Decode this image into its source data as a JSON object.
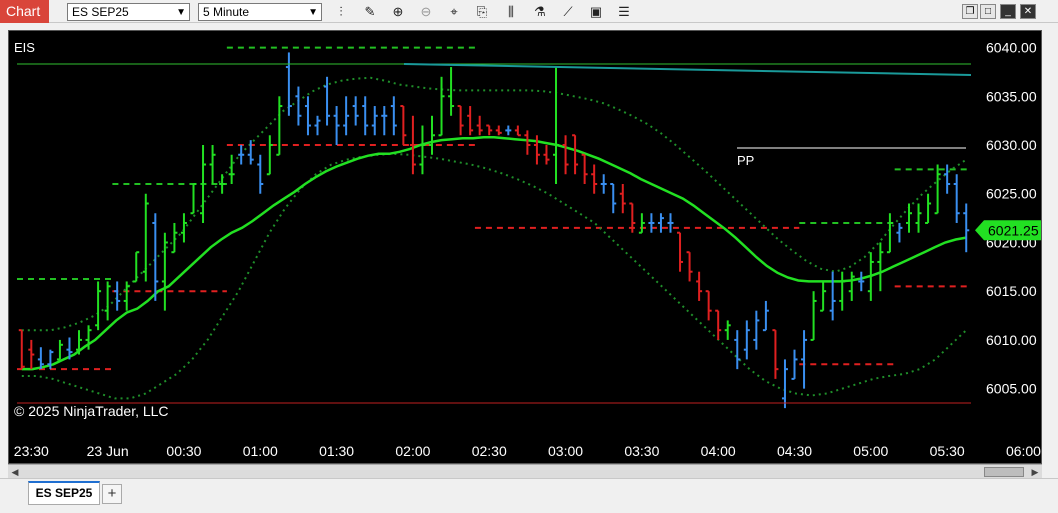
{
  "window": {
    "chart_label": "Chart"
  },
  "toolbar": {
    "instrument_select": "ES SEP25",
    "interval_select": "5 Minute",
    "icons": [
      "bar-type-icon",
      "draw-pencil-icon",
      "zoom-in-icon",
      "zoom-out-icon",
      "crosshair-icon",
      "properties-icon",
      "indicators-icon",
      "strategies-icon",
      "chart-trader-icon",
      "data-box-icon"
    ],
    "window_buttons": [
      "restore",
      "maximize",
      "minimize",
      "close"
    ]
  },
  "chart": {
    "instrument_label": "EIS",
    "copyright": "© 2025 NinjaTrader, LLC",
    "pivot_label": "PP",
    "last_price": "6021.25",
    "colors": {
      "background": "#000000",
      "up_bar": "#22e022",
      "down_bar": "#e02020",
      "neutral_bar": "#3a8ff0",
      "sma": "#22e022",
      "band": "#1f8f2a",
      "last_price_tag": "#22e022"
    },
    "y_axis_ticks": [
      "6040.00",
      "6035.00",
      "6030.00",
      "6025.00",
      "6020.00",
      "6015.00",
      "6010.00",
      "6005.00"
    ],
    "x_axis_ticks": [
      "23:30",
      "23 Jun",
      "00:30",
      "01:00",
      "01:30",
      "02:00",
      "02:30",
      "03:00",
      "03:30",
      "04:00",
      "04:30",
      "05:00",
      "05:30",
      "06:00"
    ]
  },
  "chart_data": {
    "type": "ohlc",
    "ylim": [
      6002.5,
      6041.7
    ],
    "bars": [
      {
        "o": 6011,
        "h": 6011,
        "l": 6007,
        "c": 6007.25,
        "d": -1
      },
      {
        "o": 6009,
        "h": 6010,
        "l": 6007,
        "c": 6008.5,
        "d": -1
      },
      {
        "o": 6008,
        "h": 6009.25,
        "l": 6007,
        "c": 6007.5,
        "d": 0
      },
      {
        "o": 6007.5,
        "h": 6009,
        "l": 6007,
        "c": 6008.75,
        "d": 0
      },
      {
        "o": 6008,
        "h": 6010,
        "l": 6008,
        "c": 6009.5,
        "d": 1
      },
      {
        "o": 6009,
        "h": 6010.25,
        "l": 6008,
        "c": 6008.75,
        "d": 0
      },
      {
        "o": 6009,
        "h": 6011,
        "l": 6008.5,
        "c": 6010,
        "d": 1
      },
      {
        "o": 6010,
        "h": 6011.5,
        "l": 6009,
        "c": 6011,
        "d": 1
      },
      {
        "o": 6011.5,
        "h": 6016,
        "l": 6011,
        "c": 6015,
        "d": 1
      },
      {
        "o": 6013,
        "h": 6016,
        "l": 6012,
        "c": 6015.5,
        "d": 1
      },
      {
        "o": 6015,
        "h": 6016,
        "l": 6013,
        "c": 6014,
        "d": 0
      },
      {
        "o": 6014,
        "h": 6016,
        "l": 6013,
        "c": 6015.5,
        "d": 1
      },
      {
        "o": 6016,
        "h": 6019,
        "l": 6016,
        "c": 6019,
        "d": 1
      },
      {
        "o": 6017,
        "h": 6025,
        "l": 6016,
        "c": 6024,
        "d": 1
      },
      {
        "o": 6022,
        "h": 6023,
        "l": 6014,
        "c": 6016,
        "d": 0
      },
      {
        "o": 6016,
        "h": 6021,
        "l": 6013,
        "c": 6020,
        "d": 1
      },
      {
        "o": 6019,
        "h": 6022,
        "l": 6019,
        "c": 6021,
        "d": 1
      },
      {
        "o": 6021,
        "h": 6023,
        "l": 6020,
        "c": 6022,
        "d": 1
      },
      {
        "o": 6023,
        "h": 6026,
        "l": 6023,
        "c": 6026,
        "d": 1
      },
      {
        "o": 6023,
        "h": 6030,
        "l": 6022,
        "c": 6028,
        "d": 1
      },
      {
        "o": 6028,
        "h": 6030,
        "l": 6026,
        "c": 6029,
        "d": 1
      },
      {
        "o": 6026,
        "h": 6027,
        "l": 6025,
        "c": 6026,
        "d": 1
      },
      {
        "o": 6027,
        "h": 6029,
        "l": 6026,
        "c": 6027,
        "d": 1
      },
      {
        "o": 6029,
        "h": 6030,
        "l": 6028,
        "c": 6029,
        "d": 0
      },
      {
        "o": 6029,
        "h": 6030.5,
        "l": 6028,
        "c": 6028.5,
        "d": 0
      },
      {
        "o": 6028,
        "h": 6029,
        "l": 6025,
        "c": 6026,
        "d": 0
      },
      {
        "o": 6027,
        "h": 6031,
        "l": 6027,
        "c": 6030,
        "d": 1
      },
      {
        "o": 6029,
        "h": 6035,
        "l": 6029,
        "c": 6034,
        "d": 1
      },
      {
        "o": 6038,
        "h": 6039.5,
        "l": 6033,
        "c": 6034,
        "d": 0
      },
      {
        "o": 6035,
        "h": 6036,
        "l": 6032,
        "c": 6033,
        "d": 0
      },
      {
        "o": 6034,
        "h": 6035,
        "l": 6031,
        "c": 6032,
        "d": 0
      },
      {
        "o": 6032,
        "h": 6033,
        "l": 6031,
        "c": 6032.5,
        "d": 0
      },
      {
        "o": 6036,
        "h": 6037,
        "l": 6032,
        "c": 6033,
        "d": 0
      },
      {
        "o": 6033,
        "h": 6034,
        "l": 6030,
        "c": 6032,
        "d": 0
      },
      {
        "o": 6032,
        "h": 6035,
        "l": 6031,
        "c": 6033,
        "d": 0
      },
      {
        "o": 6034,
        "h": 6035,
        "l": 6032,
        "c": 6033,
        "d": 0
      },
      {
        "o": 6034,
        "h": 6035,
        "l": 6031,
        "c": 6032,
        "d": 0
      },
      {
        "o": 6032,
        "h": 6034,
        "l": 6031,
        "c": 6033,
        "d": 0
      },
      {
        "o": 6033,
        "h": 6034,
        "l": 6031,
        "c": 6033,
        "d": 0
      },
      {
        "o": 6034,
        "h": 6035,
        "l": 6031,
        "c": 6032,
        "d": 0
      },
      {
        "o": 6034,
        "h": 6034,
        "l": 6030,
        "c": 6031,
        "d": -1
      },
      {
        "o": 6030,
        "h": 6033,
        "l": 6027,
        "c": 6028,
        "d": -1
      },
      {
        "o": 6028,
        "h": 6032,
        "l": 6027,
        "c": 6030,
        "d": 1
      },
      {
        "o": 6030,
        "h": 6033,
        "l": 6029,
        "c": 6031,
        "d": 1
      },
      {
        "o": 6031,
        "h": 6037,
        "l": 6031,
        "c": 6035,
        "d": 1
      },
      {
        "o": 6035,
        "h": 6038,
        "l": 6033,
        "c": 6034,
        "d": 1
      },
      {
        "o": 6034,
        "h": 6034,
        "l": 6031,
        "c": 6032,
        "d": -1
      },
      {
        "o": 6033,
        "h": 6034,
        "l": 6031,
        "c": 6031.5,
        "d": -1
      },
      {
        "o": 6032,
        "h": 6033,
        "l": 6031,
        "c": 6031.5,
        "d": -1
      },
      {
        "o": 6032,
        "h": 6032,
        "l": 6031,
        "c": 6031.5,
        "d": -1
      },
      {
        "o": 6031.5,
        "h": 6032,
        "l": 6031,
        "c": 6031.25,
        "d": -1
      },
      {
        "o": 6031.5,
        "h": 6032,
        "l": 6031,
        "c": 6031.5,
        "d": 0
      },
      {
        "o": 6031.5,
        "h": 6032,
        "l": 6031,
        "c": 6031,
        "d": -1
      },
      {
        "o": 6031,
        "h": 6031.5,
        "l": 6029,
        "c": 6030,
        "d": -1
      },
      {
        "o": 6030,
        "h": 6031,
        "l": 6028,
        "c": 6029,
        "d": -1
      },
      {
        "o": 6029,
        "h": 6030,
        "l": 6028,
        "c": 6028.5,
        "d": -1
      },
      {
        "o": 6029,
        "h": 6038,
        "l": 6026,
        "c": 6030,
        "d": 1
      },
      {
        "o": 6030,
        "h": 6031,
        "l": 6027,
        "c": 6028,
        "d": -1
      },
      {
        "o": 6031,
        "h": 6031,
        "l": 6027,
        "c": 6028,
        "d": -1
      },
      {
        "o": 6029,
        "h": 6029,
        "l": 6026,
        "c": 6027,
        "d": -1
      },
      {
        "o": 6027,
        "h": 6028,
        "l": 6025,
        "c": 6026,
        "d": -1
      },
      {
        "o": 6026,
        "h": 6027,
        "l": 6025,
        "c": 6026,
        "d": 0
      },
      {
        "o": 6026,
        "h": 6026,
        "l": 6023,
        "c": 6024,
        "d": 0
      },
      {
        "o": 6025,
        "h": 6026,
        "l": 6023,
        "c": 6024,
        "d": -1
      },
      {
        "o": 6024,
        "h": 6024,
        "l": 6021,
        "c": 6022,
        "d": -1
      },
      {
        "o": 6021,
        "h": 6023,
        "l": 6021,
        "c": 6022,
        "d": 1
      },
      {
        "o": 6022,
        "h": 6023,
        "l": 6021,
        "c": 6022,
        "d": 0
      },
      {
        "o": 6022,
        "h": 6023,
        "l": 6021,
        "c": 6022.5,
        "d": 0
      },
      {
        "o": 6022,
        "h": 6023,
        "l": 6021,
        "c": 6022,
        "d": 0
      },
      {
        "o": 6021,
        "h": 6021,
        "l": 6017,
        "c": 6018,
        "d": -1
      },
      {
        "o": 6019,
        "h": 6019,
        "l": 6016,
        "c": 6017,
        "d": -1
      },
      {
        "o": 6016,
        "h": 6017,
        "l": 6014,
        "c": 6015,
        "d": -1
      },
      {
        "o": 6015,
        "h": 6015,
        "l": 6012,
        "c": 6013,
        "d": -1
      },
      {
        "o": 6013,
        "h": 6013,
        "l": 6010,
        "c": 6011,
        "d": -1
      },
      {
        "o": 6011,
        "h": 6012,
        "l": 6010,
        "c": 6011.5,
        "d": 1
      },
      {
        "o": 6010,
        "h": 6011,
        "l": 6007,
        "c": 6008,
        "d": 0
      },
      {
        "o": 6009,
        "h": 6012,
        "l": 6008,
        "c": 6011,
        "d": 0
      },
      {
        "o": 6010,
        "h": 6013,
        "l": 6009,
        "c": 6012,
        "d": 0
      },
      {
        "o": 6011,
        "h": 6014,
        "l": 6011,
        "c": 6013,
        "d": 0
      },
      {
        "o": 6011,
        "h": 6011,
        "l": 6006,
        "c": 6007,
        "d": -1
      },
      {
        "o": 6004,
        "h": 6008,
        "l": 6003,
        "c": 6007,
        "d": 0
      },
      {
        "o": 6006,
        "h": 6009,
        "l": 6006,
        "c": 6008,
        "d": 0
      },
      {
        "o": 6008,
        "h": 6011,
        "l": 6005,
        "c": 6010,
        "d": 0
      },
      {
        "o": 6010,
        "h": 6015,
        "l": 6010,
        "c": 6014,
        "d": 1
      },
      {
        "o": 6013,
        "h": 6016,
        "l": 6013,
        "c": 6015,
        "d": 1
      },
      {
        "o": 6013,
        "h": 6017,
        "l": 6012,
        "c": 6014,
        "d": 0
      },
      {
        "o": 6014,
        "h": 6017,
        "l": 6013,
        "c": 6016,
        "d": 1
      },
      {
        "o": 6015,
        "h": 6017,
        "l": 6014,
        "c": 6016.5,
        "d": 1
      },
      {
        "o": 6016,
        "h": 6017,
        "l": 6015,
        "c": 6016,
        "d": 0
      },
      {
        "o": 6015,
        "h": 6019,
        "l": 6014,
        "c": 6018,
        "d": 1
      },
      {
        "o": 6018,
        "h": 6020,
        "l": 6015,
        "c": 6019,
        "d": 1
      },
      {
        "o": 6019,
        "h": 6023,
        "l": 6019,
        "c": 6022,
        "d": 1
      },
      {
        "o": 6021,
        "h": 6022,
        "l": 6020,
        "c": 6021.5,
        "d": 0
      },
      {
        "o": 6022,
        "h": 6024,
        "l": 6021,
        "c": 6023,
        "d": 1
      },
      {
        "o": 6022,
        "h": 6024,
        "l": 6021,
        "c": 6023,
        "d": 1
      },
      {
        "o": 6022,
        "h": 6025,
        "l": 6022,
        "c": 6024,
        "d": 1
      },
      {
        "o": 6023,
        "h": 6028,
        "l": 6023,
        "c": 6027,
        "d": 1
      },
      {
        "o": 6027,
        "h": 6028,
        "l": 6025,
        "c": 6026,
        "d": 0
      },
      {
        "o": 6026,
        "h": 6027,
        "l": 6022,
        "c": 6023,
        "d": 0
      },
      {
        "o": 6023,
        "h": 6024,
        "l": 6019,
        "c": 6021.25,
        "d": 0
      }
    ],
    "sma": [
      6007,
      6007,
      6007.2,
      6007.5,
      6008,
      6008.5,
      6009.3,
      6010,
      6011,
      6012,
      6012.8,
      6013.2,
      6014,
      6015,
      6015.5,
      6016.5,
      6017.5,
      6018.5,
      6019.5,
      6020.3,
      6021,
      6021.5,
      6022.2,
      6023,
      6023.8,
      6024.5,
      6025.2,
      6026,
      6026.7,
      6027.3,
      6027.8,
      6028.2,
      6028.6,
      6028.9,
      6029.1,
      6029.1,
      6029.3,
      6029.6,
      6030,
      6030.3,
      6030.5,
      6030.6,
      6030.7,
      6030.7,
      6030.8,
      6030.8,
      6030.7,
      6030.6,
      6030.5,
      6030.4,
      6030.2,
      6030,
      6029.7,
      6029.4,
      6029,
      6028.6,
      6028.1,
      6027.6,
      6027.1,
      6026.5,
      6026,
      6025.5,
      6025,
      6024.5,
      6023.8,
      6023,
      6022.2,
      6021.4,
      6020.5,
      6019.5,
      6018.5,
      6017.6,
      6016.9,
      6016.4,
      6016.1,
      6016,
      6016,
      6016,
      6016,
      6016.1,
      6016.3,
      6016.6,
      6017,
      6017.5,
      6018,
      6018.5,
      6019,
      6019.5,
      6020,
      6020.3,
      6020.5
    ],
    "sma_start": 0,
    "band_upper": [
      6011,
      6011,
      6011,
      6011.3,
      6011.8,
      6012.5,
      6013.5,
      6015,
      6016.5,
      6018,
      6019.5,
      6021,
      6023,
      6025,
      6027,
      6029,
      6030.5,
      6032,
      6033.5,
      6034.5,
      6035.5,
      6036.2,
      6036.6,
      6036.8,
      6036.9,
      6036.6,
      6036.2,
      6036,
      6035.8,
      6035.7,
      6035.6,
      6035.6,
      6035.6,
      6035.6,
      6035.6,
      6035.6,
      6035.5,
      6035.3,
      6035,
      6034.7,
      6034.3,
      6033.7,
      6033,
      6032.2,
      6031.2,
      6030,
      6028.7,
      6027.4,
      6026,
      6024.6,
      6023.2,
      6021.8,
      6020.4,
      6019.2,
      6018.1,
      6017.3,
      6017,
      6017.5,
      6018.5,
      6020,
      6021.8,
      6023.5,
      6025,
      6026.3,
      6027.5,
      6028.5
    ],
    "band_upper_start": 0,
    "band_lower": [
      6006.3,
      6006.3,
      6006,
      6005.5,
      6005,
      6004.5,
      6004,
      6004,
      6004.5,
      6005.5,
      6006.5,
      6008,
      6010,
      6012.5,
      6015,
      6018,
      6021,
      6023.5,
      6025.5,
      6027,
      6028,
      6028.5,
      6028.8,
      6029,
      6029.1,
      6029,
      6028.8,
      6028.6,
      6028.3,
      6028,
      6027.6,
      6027.1,
      6026.5,
      6025.8,
      6025,
      6024,
      6023,
      6022,
      6020.5,
      6019,
      6017.5,
      6016,
      6014.5,
      6013,
      6011.5,
      6010,
      6008.5,
      6007,
      6005.8,
      6005,
      6004.5,
      6004.3,
      6004.5,
      6005,
      6005.5,
      6006,
      6006.3,
      6006.5,
      6007,
      6008,
      6009.5,
      6011
    ],
    "band_lower_start": 0,
    "levels": [
      {
        "type": "dashed",
        "color": "#22c022",
        "y": 6016.25,
        "x0": 0,
        "x1": 10
      },
      {
        "type": "dashed",
        "color": "#e02020",
        "y": 6015,
        "x0": 10,
        "x1": 22
      },
      {
        "type": "dashed",
        "color": "#e02020",
        "y": 6007,
        "x0": 0,
        "x1": 10
      },
      {
        "type": "dashed",
        "color": "#22c022",
        "y": 6026,
        "x0": 10,
        "x1": 22
      },
      {
        "type": "dashed",
        "color": "#e02020",
        "y": 6030,
        "x0": 22,
        "x1": 48
      },
      {
        "type": "dashed",
        "color": "#22c022",
        "y": 6040,
        "x0": 22,
        "x1": 48
      },
      {
        "type": "dashed",
        "color": "#e02020",
        "y": 6021.5,
        "x0": 48,
        "x1": 82
      },
      {
        "type": "dashed",
        "color": "#22c022",
        "y": 6022,
        "x0": 82,
        "x1": 92
      },
      {
        "type": "dashed",
        "color": "#e02020",
        "y": 6007.5,
        "x0": 82,
        "x1": 92
      },
      {
        "type": "dashed",
        "color": "#e02020",
        "y": 6015.5,
        "x0": 92,
        "x1": 106
      },
      {
        "type": "dashed",
        "color": "#22c022",
        "y": 6027.5,
        "x0": 92,
        "x1": 116
      }
    ],
    "x_tick_bar_index": [
      1,
      9,
      17,
      25,
      33,
      41,
      49,
      57,
      65,
      73,
      81,
      89,
      97,
      105
    ],
    "y_tick_values": [
      6040,
      6035,
      6030,
      6025,
      6020,
      6015,
      6010,
      6005
    ]
  }
}
